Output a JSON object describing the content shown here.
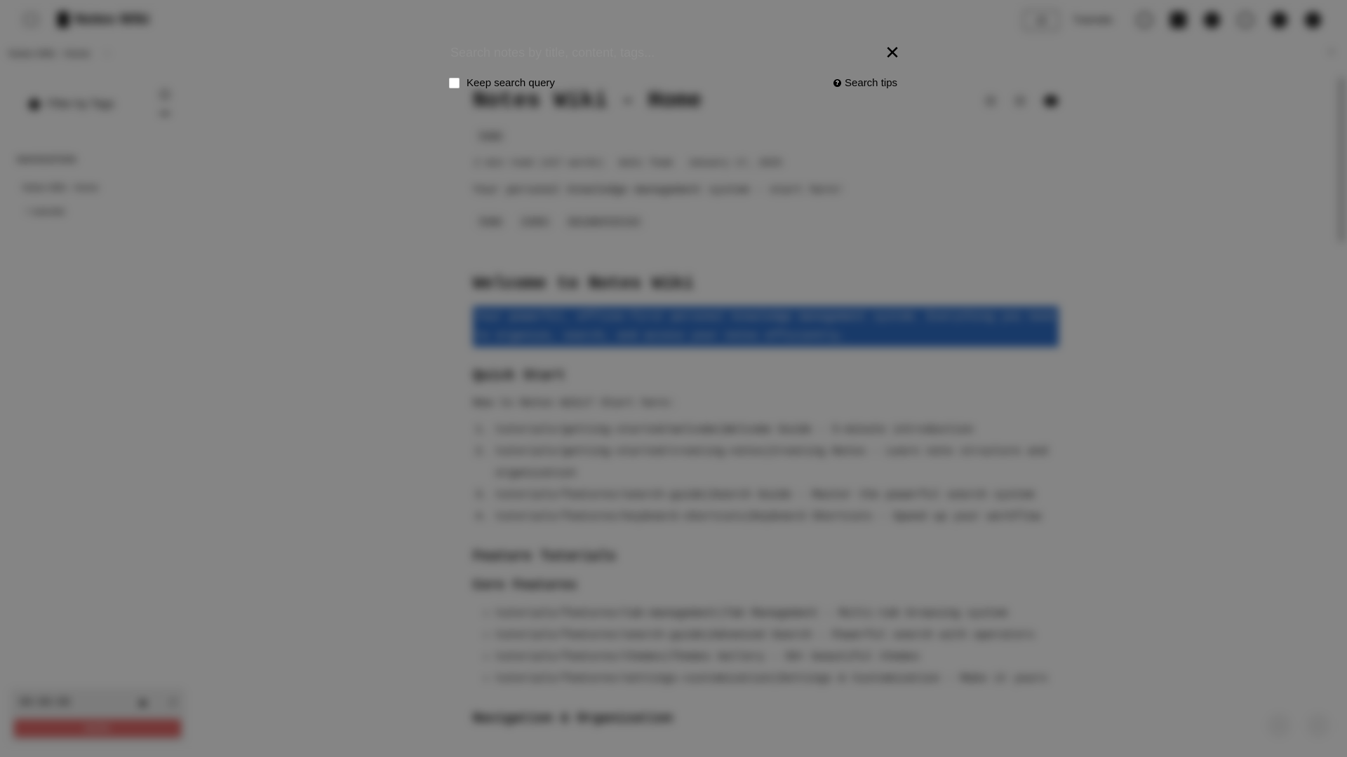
{
  "header": {
    "app_title": "Notes Wiki",
    "scope_button": "All",
    "tutorials_label": "Tutorials",
    "icons": [
      "search-icon",
      "chat-icon",
      "star-icon",
      "layout-icon",
      "bell-icon",
      "settings-icon"
    ]
  },
  "breadcrumb": {
    "path": "Notes Wiki - Home",
    "close": "×"
  },
  "sidebar": {
    "filter_label": "Filter by Tags",
    "nav_heading": "NAVIGATION",
    "nav_items": [
      "Notes Wiki - Home",
      "> tutorials"
    ]
  },
  "pomodoro": {
    "time": "00:00:00",
    "play": "▶",
    "reset": "↺",
    "mode": "WORK"
  },
  "document": {
    "title": "Notes Wiki - Home",
    "context_tag": "home",
    "read_time": "2 min read",
    "word_count": "(417 words)",
    "author": "Wiki Team",
    "date": "January 17, 2025",
    "subtitle": "Your personal knowledge management system - start here!",
    "tags": [
      "home",
      "index",
      "documentation"
    ],
    "welcome_heading": "Welcome to Notes Wiki",
    "intro": "Your powerful, offline-first personal knowledge management system. Everything you need to organize, search, and access your notes efficiently.",
    "quick_start_heading": "Quick Start",
    "new_line": "New to Notes Wiki? Start here:",
    "quick_start_items": [
      "tutorials/getting-started/welcome|Welcome Guide - 5-minute introduction",
      "tutorials/getting-started/creating-notes|Creating Notes - Learn note structure and organization",
      "tutorials/features/search-guide|Search Guide - Master the powerful search system",
      "tutorials/features/keyboard-shortcuts|Keyboard Shortcuts - Speed up your workflow"
    ],
    "feature_tutorials_heading": "Feature Tutorials",
    "core_features_heading": "Core Features",
    "core_features_items": [
      "tutorials/features/tab-management|Tab Management - Multi-tab browsing system",
      "tutorials/features/search-guide|Advanced Search - Powerful search with operators",
      "tutorials/features/themes|Themes Gallery - 50+ beautiful themes",
      "tutorials/features/settings-customization|Settings & Customization - Make it yours"
    ],
    "navigation_heading": "Navigation & Organization"
  },
  "search": {
    "placeholder": "Search notes by title, content, tags...",
    "close_symbol": "✕",
    "keep_query_label": "Keep search query",
    "keep_query_checked": false,
    "tips_icon": "?",
    "tips_label": "Search tips"
  },
  "colors": {
    "overlay": "rgba(0,0,0,0.48)",
    "selection": "#2f6fca",
    "pomodoro_bar": "#e36a6a"
  }
}
